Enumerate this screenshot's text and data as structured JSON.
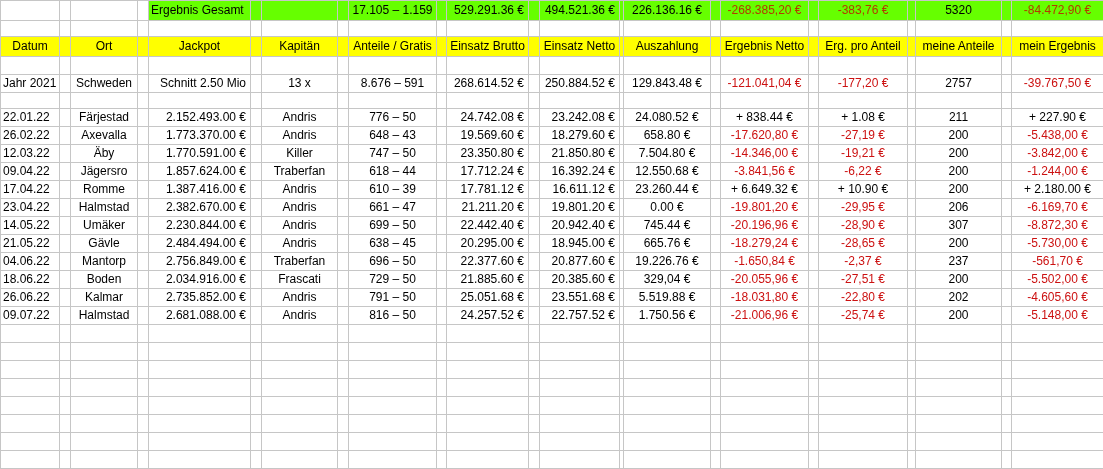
{
  "summary": {
    "label": "Ergebnis Gesamt",
    "values": [
      "17.105 – 1.159",
      "529.291.36 €",
      "494.521.36 €",
      "226.136.16 €",
      "-268.385,20 €",
      "-383,76 €",
      "5320",
      "-84.472,90 €"
    ],
    "negative": true
  },
  "columns": [
    "Datum",
    "Ort",
    "Jackpot",
    "Kapitän",
    "Anteile / Gratis",
    "Einsatz Brutto",
    "Einsatz Netto",
    "Auszahlung",
    "Ergebnis Netto",
    "Erg. pro Anteil",
    "meine Anteile",
    "mein Ergebnis"
  ],
  "year_row": {
    "cells": [
      "Jahr 2021",
      "Schweden",
      "Schnitt 2.50 Mio",
      "13 x",
      "8.676 – 591",
      "268.614.52 €",
      "250.884.52 €",
      "129.843.48 €",
      "-121.041,04 €",
      "-177,20 €",
      "2757",
      "-39.767,50 €"
    ],
    "negative": true
  },
  "rows": [
    {
      "cells": [
        "22.01.22",
        "Färjestad",
        "2.152.493.00 €",
        "Andris",
        "776 – 50",
        "24.742.08 €",
        "23.242.08 €",
        "24.080.52 €",
        "+ 838.44 €",
        "+ 1.08 €",
        "211",
        "+ 227.90 €"
      ],
      "negative": false
    },
    {
      "cells": [
        "26.02.22",
        "Axevalla",
        "1.773.370.00 €",
        "Andris",
        "648 – 43",
        "19.569.60 €",
        "18.279.60 €",
        "658.80 €",
        "-17.620,80 €",
        "-27,19 €",
        "200",
        "-5.438,00 €"
      ],
      "negative": true
    },
    {
      "cells": [
        "12.03.22",
        "Äby",
        "1.770.591.00 €",
        "Killer",
        "747 – 50",
        "23.350.80 €",
        "21.850.80 €",
        "7.504.80 €",
        "-14.346,00 €",
        "-19,21 €",
        "200",
        "-3.842,00 €"
      ],
      "negative": true
    },
    {
      "cells": [
        "09.04.22",
        "Jägersro",
        "1.857.624.00 €",
        "Traberfan",
        "618 – 44",
        "17.712.24 €",
        "16.392.24 €",
        "12.550.68 €",
        "-3.841,56 €",
        "-6,22 €",
        "200",
        "-1.244,00 €"
      ],
      "negative": true
    },
    {
      "cells": [
        "17.04.22",
        "Romme",
        "1.387.416.00 €",
        "Andris",
        "610 – 39",
        "17.781.12 €",
        "16.611.12 €",
        "23.260.44 €",
        "+ 6.649.32 €",
        "+ 10.90 €",
        "200",
        "+ 2.180.00 €"
      ],
      "negative": false
    },
    {
      "cells": [
        "23.04.22",
        "Halmstad",
        "2.382.670.00 €",
        "Andris",
        "661 – 47",
        "21.211.20 €",
        "19.801.20 €",
        "0.00 €",
        "-19.801,20 €",
        "-29,95 €",
        "206",
        "-6.169,70 €"
      ],
      "negative": true
    },
    {
      "cells": [
        "14.05.22",
        "Umäker",
        "2.230.844.00 €",
        "Andris",
        "699 – 50",
        "22.442.40 €",
        "20.942.40 €",
        "745.44 €",
        "-20.196,96 €",
        "-28,90 €",
        "307",
        "-8.872,30 €"
      ],
      "negative": true
    },
    {
      "cells": [
        "21.05.22",
        "Gävle",
        "2.484.494.00 €",
        "Andris",
        "638 – 45",
        "20.295.00 €",
        "18.945.00 €",
        "665.76 €",
        "-18.279,24 €",
        "-28,65 €",
        "200",
        "-5.730,00 €"
      ],
      "negative": true
    },
    {
      "cells": [
        "04.06.22",
        "Mantorp",
        "2.756.849.00 €",
        "Traberfan",
        "696 – 50",
        "22.377.60 €",
        "20.877.60 €",
        "19.226.76 €",
        "-1.650,84 €",
        "-2,37 €",
        "237",
        "-561,70 €"
      ],
      "negative": true
    },
    {
      "cells": [
        "18.06.22",
        "Boden",
        "2.034.916.00 €",
        "Frascati",
        "729 – 50",
        "21.885.60 €",
        "20.385.60 €",
        "329,04 €",
        "-20.055,96 €",
        "-27,51 €",
        "200",
        "-5.502,00 €"
      ],
      "negative": true
    },
    {
      "cells": [
        "26.06.22",
        "Kalmar",
        "2.735.852.00 €",
        "Andris",
        "791 – 50",
        "25.051.68 €",
        "23.551.68 €",
        "5.519.88 €",
        "-18.031,80 €",
        "-22,80 €",
        "202",
        "-4.605,60 €"
      ],
      "negative": true
    },
    {
      "cells": [
        "09.07.22",
        "Halmstad",
        "2.681.088.00 €",
        "Andris",
        "816 – 50",
        "24.257.52 €",
        "22.757.52 €",
        "1.750.56 €",
        "-21.006,96 €",
        "-25,74 €",
        "200",
        "-5.148,00 €"
      ],
      "negative": true
    }
  ]
}
